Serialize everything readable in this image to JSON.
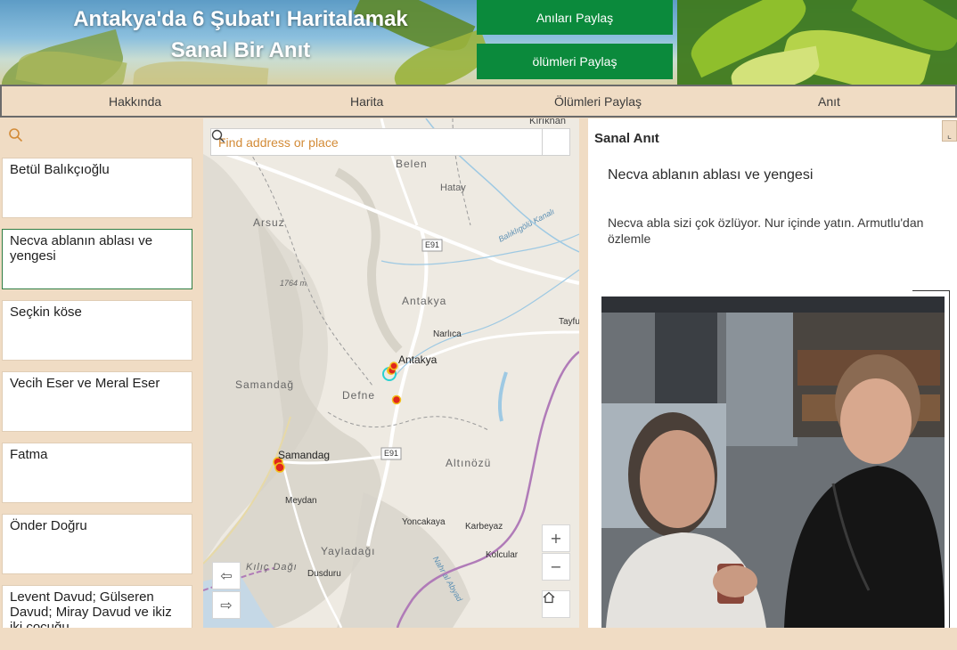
{
  "header": {
    "title_line1": "Antakya'da 6 Şubat'ı Haritalamak",
    "title_line2": "Sanal Bir Anıt",
    "btn_share_memories": "Anıları Paylaş",
    "btn_share_deaths": "ölümleri Paylaş"
  },
  "nav": {
    "items": [
      "Hakkında",
      "Harita",
      "Ölümleri Paylaş",
      "Anıt"
    ]
  },
  "sidebar": {
    "search_icon": "search-icon",
    "items": [
      "Betül Balıkçıoğlu",
      "Necva ablanın ablası ve yengesi",
      "Seçkin köse",
      "Vecih Eser ve Meral Eser",
      "Fatma",
      "Önder Doğru",
      "Levent Davud; Gülseren Davud; Miray Davud ve ikiz iki çocuğu"
    ],
    "active_index": 1
  },
  "map": {
    "search_placeholder": "Find address or place",
    "zoom_in": "+",
    "zoom_out": "−",
    "home_icon": "home-icon",
    "labels": {
      "kirikhan": "Kırıkhan",
      "belen": "Belen",
      "hatay": "Hatay",
      "arsuz": "Arsuz",
      "canal": "Balıklıgölü Kanalı",
      "e91_top": "E91",
      "elev": "1764 m",
      "antakya_area": "Antakya",
      "narlica": "Narlıca",
      "tayfur": "Tayfu",
      "antakya": "Antakya",
      "samandag_area": "Samandağ",
      "defne": "Defne",
      "samandag": "Samandag",
      "e91_bottom": "E91",
      "altinozu": "Altınözü",
      "meydan": "Meydan",
      "yoncakaya": "Yoncakaya",
      "karbeyaz": "Karbeyaz",
      "yayladagi": "Yayladağı",
      "kolcular": "Kolcular",
      "kilic": "Kılıç Dağı",
      "dusduru": "Dusduru",
      "nahr": "Nahr al Abyad"
    }
  },
  "panel": {
    "heading": "Sanal Anıt",
    "title": "Necva ablanın ablası ve yengesi",
    "text": "Necva abla sizi çok özlüyor. Nur içinde yatın. Armutlu'dan özlemle",
    "corner_icon": "expand-icon"
  },
  "colors": {
    "accent_green": "#0b8a3c",
    "beige": "#f0dcc4",
    "marker_red": "#e0261c",
    "marker_yellow": "#f3c01a",
    "border_green": "#2f7d43"
  }
}
